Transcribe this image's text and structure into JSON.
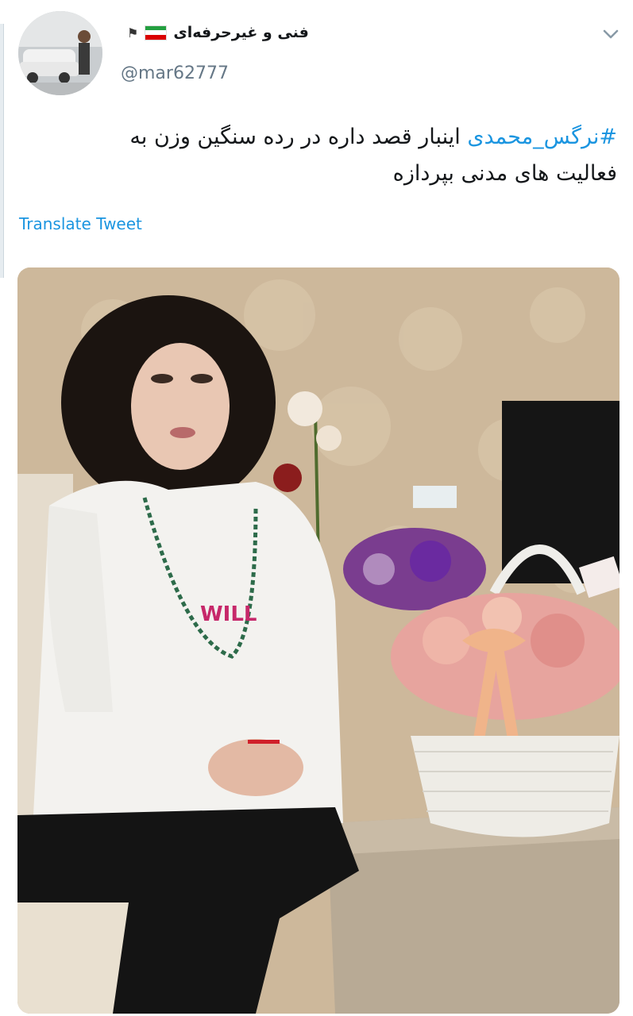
{
  "tweet": {
    "display_name": "فنی و غیرحرفه‌ای",
    "handle": "@mar62777",
    "hashtag": "#نرگس_محمدی",
    "text_rest": " اینبار قصد داره در رده سنگین وزن به فعالیت های مدنی بپردازه",
    "translate_label": "Translate Tweet"
  },
  "icons": {
    "avatar": "profile-photo",
    "flag": "iran-flag-icon",
    "pennant": "pennant-icon",
    "menu": "chevron-down-icon"
  },
  "colors": {
    "link": "#1b95e0",
    "text": "#14171a",
    "secondary": "#657786"
  }
}
